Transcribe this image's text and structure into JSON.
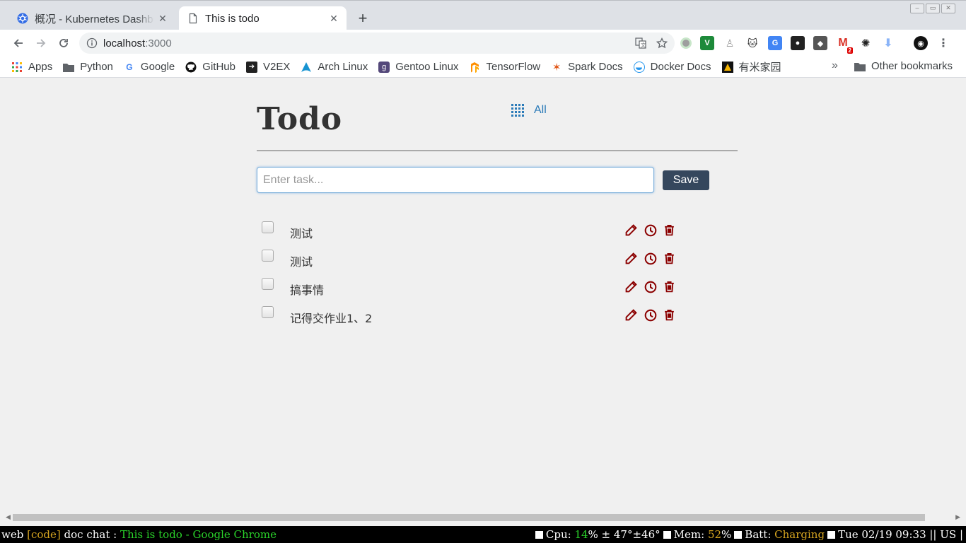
{
  "browser": {
    "tabs": [
      {
        "title": "概况 - Kubernetes Dashboard",
        "active": false
      },
      {
        "title": "This is todo",
        "active": true
      }
    ],
    "url_host": "localhost",
    "url_port": ":3000",
    "bookmarks": [
      {
        "label": "Apps",
        "icon": "apps-grid-icon"
      },
      {
        "label": "Python",
        "icon": "folder-icon"
      },
      {
        "label": "Google",
        "icon": "google-icon"
      },
      {
        "label": "GitHub",
        "icon": "github-icon"
      },
      {
        "label": "V2EX",
        "icon": "v2ex-icon"
      },
      {
        "label": "Arch Linux",
        "icon": "arch-icon"
      },
      {
        "label": "Gentoo Linux",
        "icon": "gentoo-icon"
      },
      {
        "label": "TensorFlow",
        "icon": "tensorflow-icon"
      },
      {
        "label": "Spark Docs",
        "icon": "spark-icon"
      },
      {
        "label": "Docker Docs",
        "icon": "docker-icon"
      },
      {
        "label": "有米家园",
        "icon": "youmi-icon"
      }
    ],
    "bookmarks_more": "»",
    "other_bookmarks": "Other bookmarks",
    "extension_badge": "2"
  },
  "app": {
    "title": "Todo",
    "filter_label": "All",
    "input_placeholder": "Enter task...",
    "input_value": "",
    "save_label": "Save",
    "todos": [
      {
        "text": "测试",
        "done": false
      },
      {
        "text": "测试",
        "done": false
      },
      {
        "text": "搞事情",
        "done": false
      },
      {
        "text": "记得交作业1、2",
        "done": false
      }
    ]
  },
  "statusbar": {
    "ws_web": "web",
    "ws_code": "[code]",
    "ws_rest": "doc chat :",
    "window_title": "This is todo - Google Chrome",
    "cpu_label": "Cpu:",
    "cpu_value": "14",
    "temp": "% ± 47°±46°",
    "mem_label": "Mem:",
    "mem_value": "52",
    "pct": "%",
    "batt_label": "Batt:",
    "batt_value": "Charging",
    "datetime": "Tue 02/19 09:33 || US |"
  },
  "colors": {
    "accent": "#2a7ab8",
    "save_button": "#35475d",
    "action_icons": "#8b0000"
  }
}
